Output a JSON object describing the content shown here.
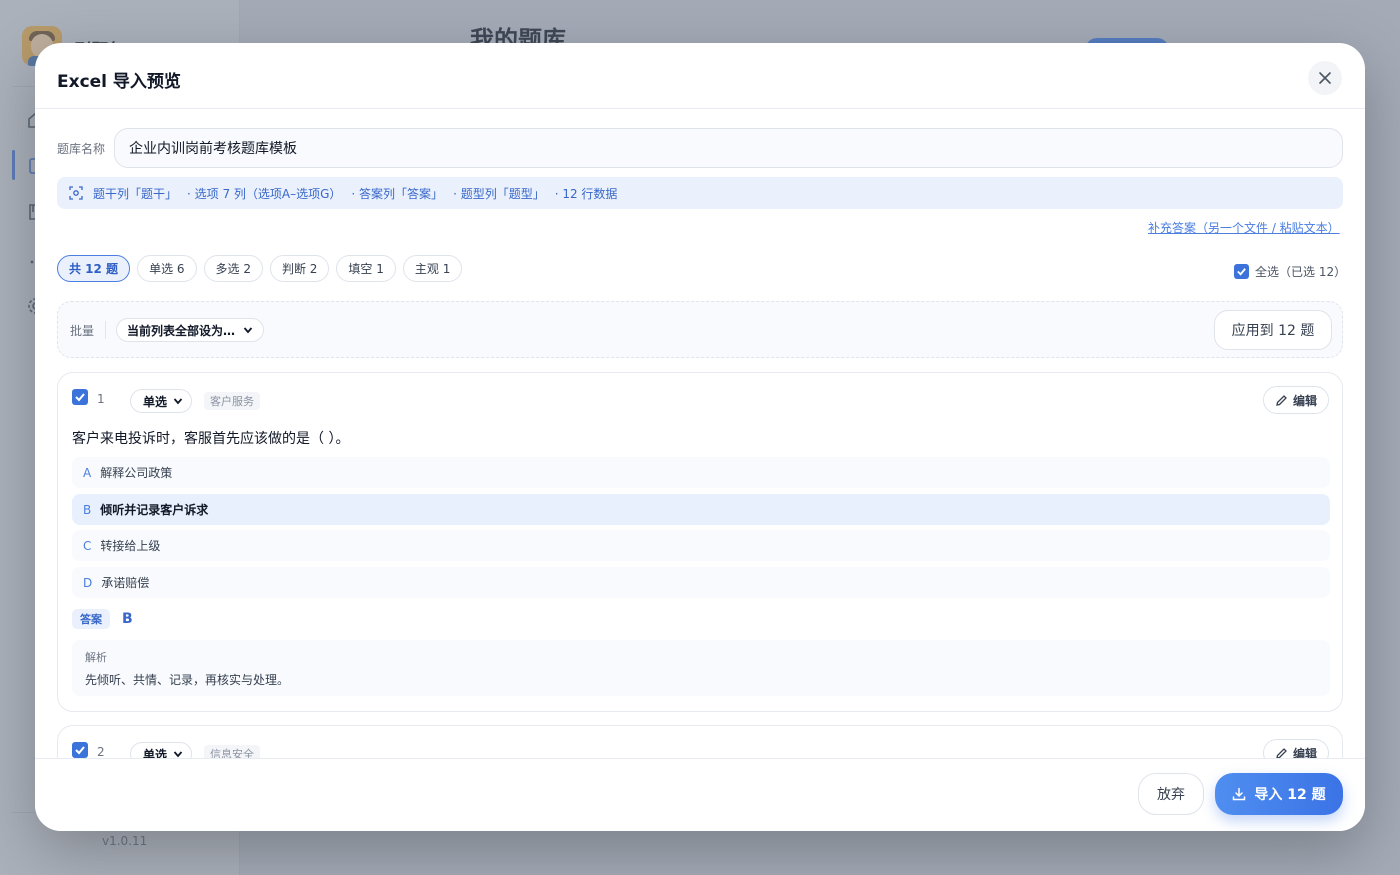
{
  "background": {
    "app_name": "刷题包",
    "page_title": "我的题库",
    "version": "v1.0.11"
  },
  "modal": {
    "title": "Excel 导入预览",
    "bank_name_label": "题库名称",
    "bank_name_value": "企业内训岗前考核题库模板",
    "info": {
      "stem_col": "题干列「题干」",
      "options": "· 选项 7 列（选项A–选项G）",
      "answer_col": "· 答案列「答案」",
      "type_col": "· 题型列「题型」",
      "rows": "· 12 行数据"
    },
    "supplement_link": "补充答案（另一个文件 / 粘贴文本）",
    "filters": [
      {
        "label": "共 12 题",
        "active": true
      },
      {
        "label": "单选 6",
        "active": false
      },
      {
        "label": "多选 2",
        "active": false
      },
      {
        "label": "判断 2",
        "active": false
      },
      {
        "label": "填空 1",
        "active": false
      },
      {
        "label": "主观 1",
        "active": false
      }
    ],
    "select_all_label": "全选（已选 12）",
    "batch": {
      "label": "批量",
      "select_value": "当前列表全部设为…",
      "apply_label": "应用到 12 题"
    },
    "questions": [
      {
        "number": "1",
        "type": "单选",
        "category": "客户服务",
        "edit_label": "编辑",
        "stem": "客户来电投诉时，客服首先应该做的是（ ）。",
        "options": [
          {
            "letter": "A",
            "text": "解释公司政策",
            "correct": false
          },
          {
            "letter": "B",
            "text": "倾听并记录客户诉求",
            "correct": true
          },
          {
            "letter": "C",
            "text": "转接给上级",
            "correct": false
          },
          {
            "letter": "D",
            "text": "承诺赔偿",
            "correct": false
          }
        ],
        "answer_label": "答案",
        "answer_value": "B",
        "explain_label": "解析",
        "explain_text": "先倾听、共情、记录，再核实与处理。"
      },
      {
        "number": "2",
        "type": "单选",
        "category": "信息安全",
        "edit_label": "编辑"
      }
    ],
    "footer": {
      "discard_label": "放弃",
      "import_label": "导入 12 题"
    }
  }
}
